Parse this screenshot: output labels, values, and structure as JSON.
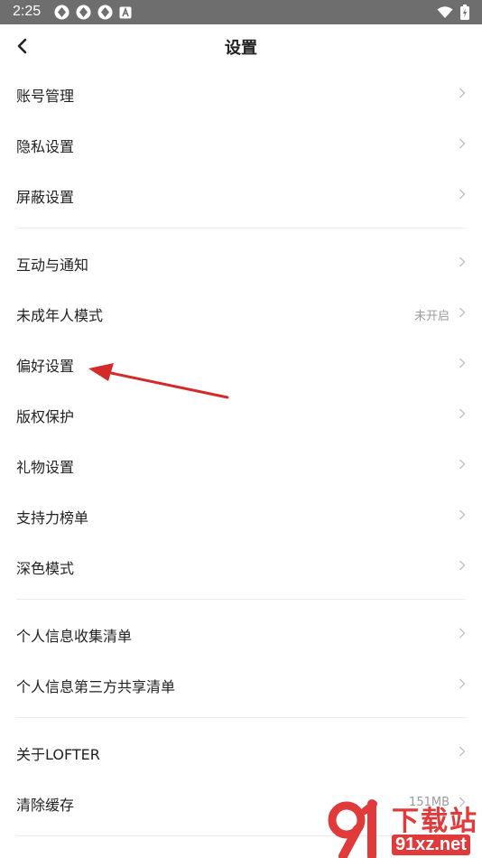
{
  "status_bar": {
    "time": "2:25",
    "icons": [
      "app-icon",
      "app-icon",
      "app-icon",
      "a-badge-icon"
    ],
    "right_icons": [
      "wifi-icon",
      "battery-icon"
    ]
  },
  "header": {
    "title": "设置"
  },
  "groups": [
    [
      {
        "label": "账号管理",
        "value": ""
      },
      {
        "label": "隐私设置",
        "value": ""
      },
      {
        "label": "屏蔽设置",
        "value": ""
      }
    ],
    [
      {
        "label": "互动与通知",
        "value": ""
      },
      {
        "label": "未成年人模式",
        "value": "未开启"
      },
      {
        "label": "偏好设置",
        "value": ""
      },
      {
        "label": "版权保护",
        "value": ""
      },
      {
        "label": "礼物设置",
        "value": ""
      },
      {
        "label": "支持力榜单",
        "value": ""
      },
      {
        "label": "深色模式",
        "value": ""
      }
    ],
    [
      {
        "label": "个人信息收集清单",
        "value": ""
      },
      {
        "label": "个人信息第三方共享清单",
        "value": ""
      }
    ],
    [
      {
        "label": "关于LOFTER",
        "value": ""
      },
      {
        "label": "清除缓存",
        "value": "151MB"
      }
    ]
  ],
  "watermark": {
    "top": "下载站",
    "bottom": "91xz.net"
  },
  "colors": {
    "statusbar": "#6e6e6e",
    "annotation_arrow": "#d42a2a",
    "watermark": "#e03a3a"
  }
}
